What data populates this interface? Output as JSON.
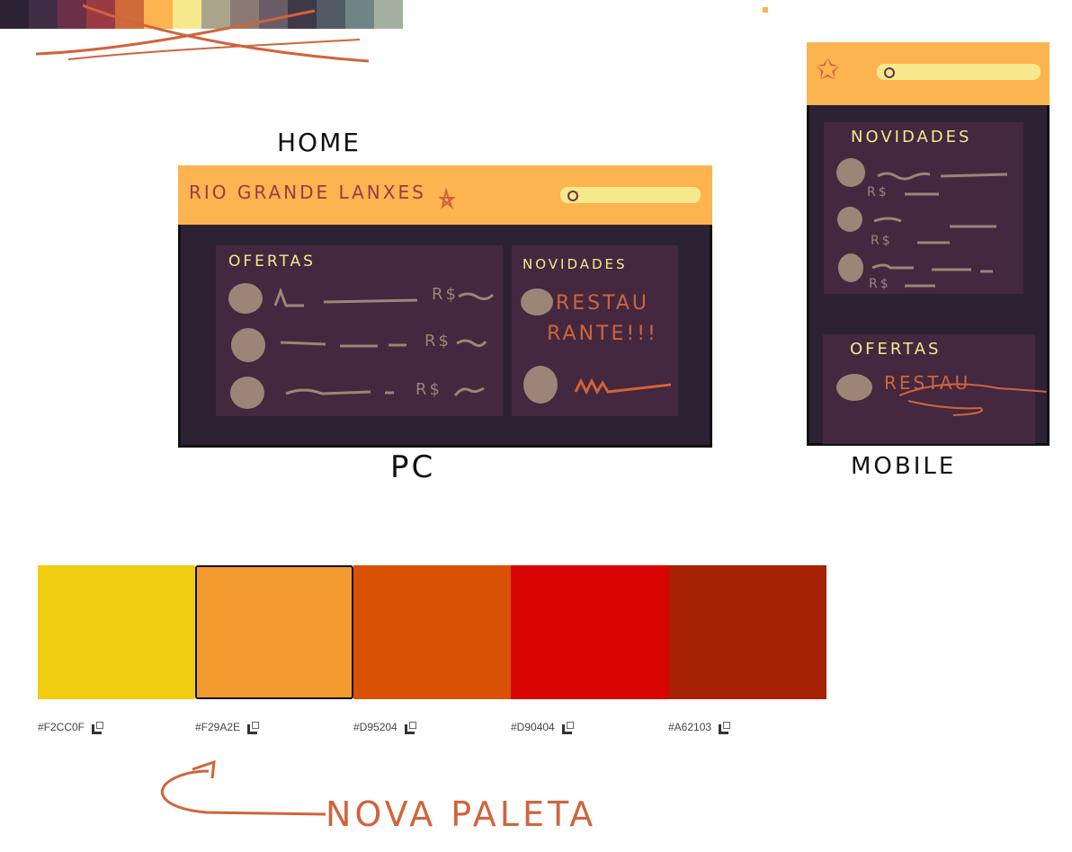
{
  "old_palette": {
    "swatches": [
      "#2d2233",
      "#3f2e45",
      "#6b2f48",
      "#9a3b44",
      "#d06a3a",
      "#fbb44f",
      "#f5e98c",
      "#a9a58b",
      "#8a7a74",
      "#6a5c66",
      "#3f3848",
      "#525a66",
      "#6f8585",
      "#a5b0a0"
    ]
  },
  "home_label": "HOME",
  "pc": {
    "label": "PC",
    "brand": "RIO GRANDE LANXES",
    "ofertas_title": "OFERTAS",
    "novidades_title": "NOVIDADES",
    "novidades_text": "RESTAU RANTE!!!",
    "price_prefix": "R$"
  },
  "mobile": {
    "label": "MOBILE",
    "novidades_title": "NOVIDADES",
    "ofertas_title": "OFERTAS",
    "ofertas_text": "RESTAU",
    "price_prefix": "R$"
  },
  "new_palette": {
    "swatches": [
      {
        "hex": "#F2CC0F",
        "color": "#F2CC0F"
      },
      {
        "hex": "#F29A2E",
        "color": "#F29A2E"
      },
      {
        "hex": "#D95204",
        "color": "#D95204"
      },
      {
        "hex": "#D90404",
        "color": "#D90404"
      },
      {
        "hex": "#A62103",
        "color": "#A62103"
      }
    ],
    "selected_index": 1
  },
  "note": "NOVA PALETA",
  "colors": {
    "header": "#fbb44f",
    "frame": "#2d2233",
    "panel": "#43283f",
    "ink_orange": "#d0643a",
    "ink_yellow": "#f5e98c",
    "scribble": "#9c8577"
  }
}
